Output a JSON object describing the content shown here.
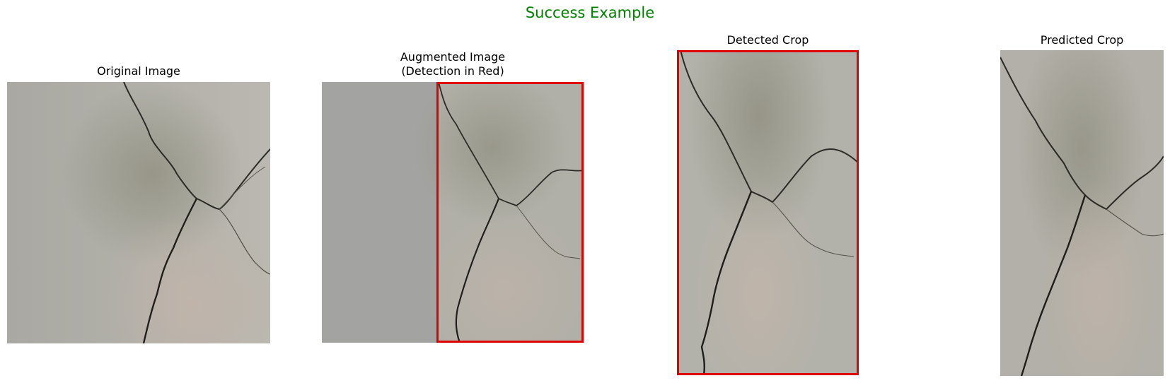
{
  "figure": {
    "title": "Success Example",
    "title_color": "#008000",
    "accent_color": "#e00000"
  },
  "panels": [
    {
      "title": "Original Image"
    },
    {
      "title_line1": "Augmented Image",
      "title_line2": "(Detection in Red)"
    },
    {
      "title": "Detected Crop"
    },
    {
      "title": "Predicted Crop"
    }
  ]
}
